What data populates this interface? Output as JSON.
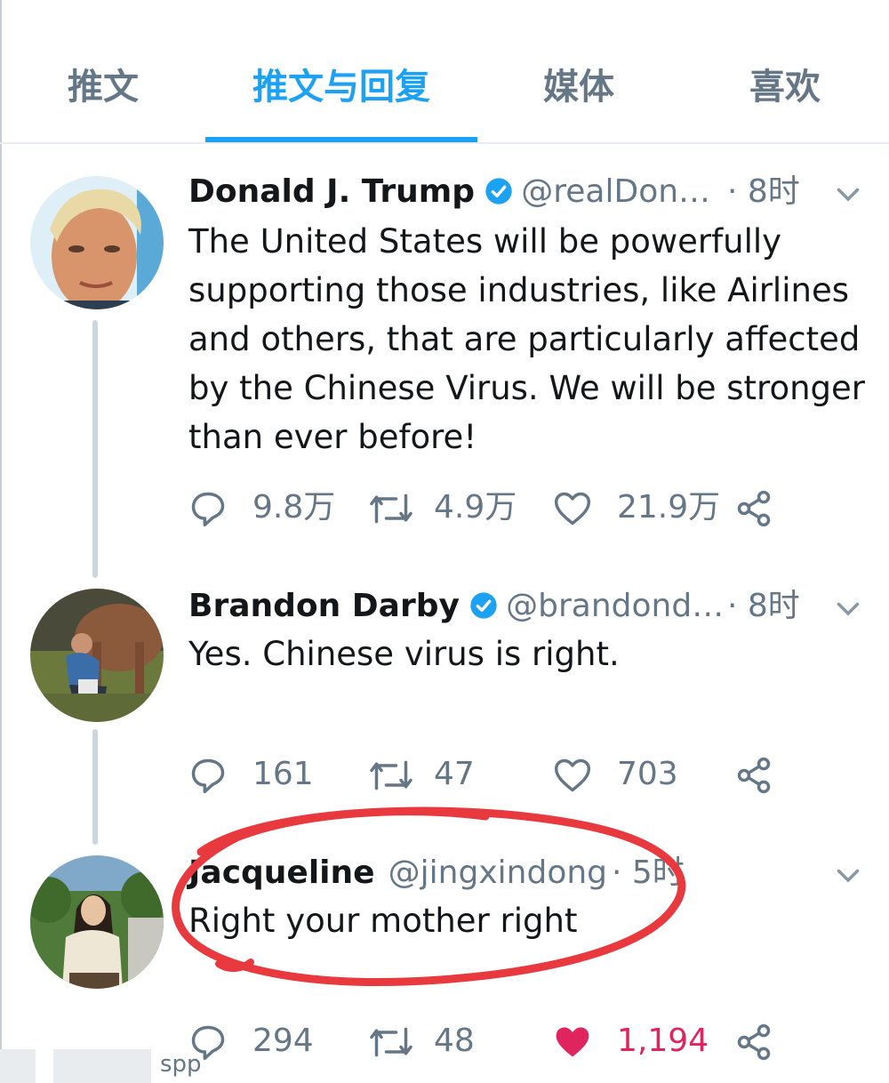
{
  "tabs": [
    {
      "label": "推文",
      "active": false
    },
    {
      "label": "推文与回复",
      "active": true
    },
    {
      "label": "媒体",
      "active": false
    },
    {
      "label": "喜欢",
      "active": false
    }
  ],
  "colors": {
    "accent": "#1da1f2",
    "like": "#e0245e",
    "annotation": "#e8393f"
  },
  "tweets": [
    {
      "name": "Donald J. Trump",
      "verified": true,
      "handle": "@realDon…",
      "time": "· 8时",
      "text": "The United States will be powerfully supporting those industries, like Airlines and others, that are particularly affected by the Chinese Virus. We will be stronger than ever before!",
      "replies": "9.8万",
      "retweets": "4.9万",
      "likes": "21.9万",
      "liked": false
    },
    {
      "name": "Brandon Darby",
      "verified": true,
      "handle": "@brandond…",
      "time": "· 8时",
      "text": "Yes. Chinese virus is right.",
      "replies": "161",
      "retweets": "47",
      "likes": "703",
      "liked": false
    },
    {
      "name": "Jacqueline",
      "verified": false,
      "handle": "@jingxindong",
      "time": "· 5时",
      "text": "Right your mother right",
      "replies": "294",
      "retweets": "48",
      "likes": "1,194",
      "liked": true
    }
  ],
  "icons": {
    "reply": "reply-icon",
    "retweet": "retweet-icon",
    "like": "heart-icon",
    "share": "share-icon",
    "verified": "verified-icon",
    "caret": "chevron-down-icon"
  },
  "watermark": "spp"
}
